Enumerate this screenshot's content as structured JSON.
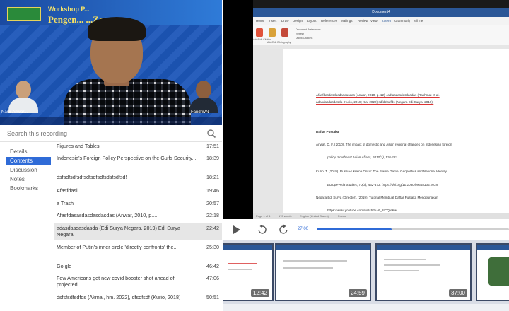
{
  "video": {
    "header_title_1": "Workshop P...",
    "header_title_2": "Pengen...   ...Zotero",
    "logo_text": "...",
    "participant_left": "Nasir Anwar...",
    "participant_right": "Farid WN"
  },
  "search": {
    "placeholder": "Search this recording"
  },
  "sidebar": {
    "items": [
      {
        "label": "Details",
        "active": false
      },
      {
        "label": "Contents",
        "active": true
      },
      {
        "label": "Discussion",
        "active": false
      },
      {
        "label": "Notes",
        "active": false
      },
      {
        "label": "Bookmarks",
        "active": false
      }
    ]
  },
  "contents": [
    {
      "title": "Figures and Tables",
      "time": "17:51"
    },
    {
      "title": "Indonesia's Foreign Policy Perspective on the Gulfs Security...",
      "time": "18:39"
    },
    {
      "title": "dsfsdfsdfsdfsdfsdfsdfsdsfsdfsd!",
      "time": "18:21"
    },
    {
      "title": "Afasfdasi",
      "time": "19:46"
    },
    {
      "title": "a Trash",
      "time": "20:57"
    },
    {
      "title": "Afasfdasasdasdasdasdas (Anwar, 2010, p....",
      "time": "22:18"
    },
    {
      "title": "adasdasdasdasda (Edi Surya Negara, 2019) Edi Surya Negara,",
      "time": "22:42"
    },
    {
      "title": "Member of Putin's inner circle 'directly confronts' the...",
      "time": "25:30"
    },
    {
      "title": "Go gle",
      "time": "46:42"
    },
    {
      "title": "Few Americans get new covid booster shot ahead of projected...",
      "time": "47:06"
    },
    {
      "title": "dsfsfsdfsdfds (Akmal, hm. 2022), dfsdfsdf (Kurio, 2018)",
      "time": "50:51"
    }
  ],
  "word": {
    "doc_title": "Document4",
    "tabs": [
      "Home",
      "Insert",
      "Draw",
      "Design",
      "Layout",
      "References",
      "Mailings",
      "Review",
      "View",
      "Zotero",
      "Grammarly",
      "Tell me"
    ],
    "active_tab": "Zotero",
    "ribbon_labels": [
      "Add/Edit Citation",
      "Add/Edit Bibliography",
      "Document Preferences",
      "Refresh",
      "Unlink Citations"
    ],
    "body_line_1": "Afasfdasdasdasdasdasdas (Anwar, 2010, p. 12) . adfasdasdasdasdas (Rakhmat et al.",
    "body_line_2": "adasdasdasdasda (Kurio, 2018; Xia, 2022) sdfdsfsdfds (Negara Edi Surya, 2019).",
    "bib_heading": "Daftar Pustaka",
    "bib": [
      "Anwar, D. F. (2010). The impact of domestic and Asian regional changes on Indonesian foreign",
      "policy. Southeast Asian Affairs, 2010(1), 126-141.",
      "Kurio, T. (2018). Russia-Ukraine Crisis: The Blame Game, Geopolitics and National Identity.",
      "Europe-Asia Studies, 70(3), 462-473. https://doi.org/10.1080/09668136.2018",
      "Negara Edi Surya (Director). (2019). Tutorial Membuat Daftar Pustaka Menggunakan",
      "https://www.youtube.com/watch?v=rl_2rCQfeKw"
    ],
    "status_items": [
      "Page 1 of 1",
      "178 words",
      "English (United States)",
      "Focus"
    ]
  },
  "player": {
    "current_time": "27:00",
    "progress": 0.39
  },
  "thumbnails": [
    {
      "time": "12:42"
    },
    {
      "time": "24:59"
    },
    {
      "time": "37:00"
    },
    {
      "time": ""
    }
  ],
  "colors": {
    "accent": "#2f6bd7",
    "video_bg": "#1c56b8",
    "word_titlebar": "#2b5797"
  }
}
